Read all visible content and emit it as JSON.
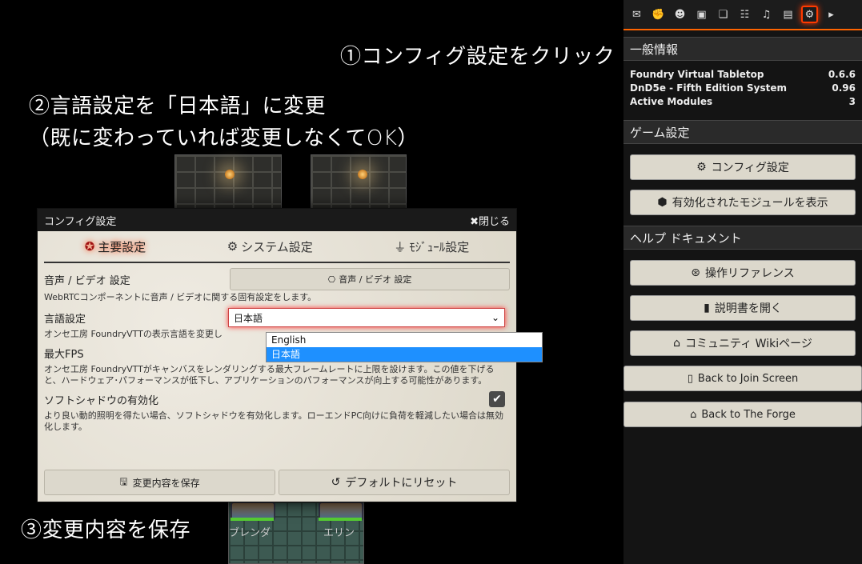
{
  "annotations": {
    "step1": "①コンフィグ設定をクリック",
    "step2a": "②言語設定を「日本語」に変更",
    "step2b": "（既に変わっていれば変更しなくてOK）",
    "step3": "③変更内容を保存"
  },
  "tokens": [
    "ブレンダ",
    "エリン"
  ],
  "dialog": {
    "title": "コンフィグ設定",
    "close": "✖閉じる",
    "tabs": [
      {
        "label": "主要設定",
        "icon": "✪"
      },
      {
        "label": "システム設定",
        "icon": "⚙"
      },
      {
        "label": "ﾓｼﾞｭｰﾙ設定",
        "icon": "⏚"
      }
    ],
    "av": {
      "label": "音声 / ビデオ 設定",
      "button": "音声 / ビデオ 設定",
      "hint": "WebRTCコンポーネントに音声 / ビデオに関する固有設定をします。"
    },
    "language": {
      "label": "言語設定",
      "value": "日本語",
      "hint": "オンセ工房 FoundryVTTの表示言語を変更し",
      "options": [
        "English",
        "日本語"
      ]
    },
    "fps": {
      "label": "最大FPS",
      "hint": "オンセ工房 FoundryVTTがキャンバスをレンダリングする最大フレームレートに上限を設けます。この値を下げると、ハードウェア･パフォーマンスが低下し、アプリケーションのパフォーマンスが向上する可能性があります。"
    },
    "softshadow": {
      "label": "ソフトシャドウの有効化",
      "hint": "より良い動的照明を得たい場合、ソフトシャドウを有効化します。ローエンドPC向けに負荷を軽減したい場合は無効化します。",
      "checked": true
    },
    "save": "変更内容を保存",
    "reset": "デフォルトにリセット"
  },
  "sidebar": {
    "tabs": [
      "chat-icon",
      "combat-icon",
      "actors-icon",
      "items-icon",
      "journal-icon",
      "tables-icon",
      "playlists-icon",
      "compendium-icon",
      "settings-icon",
      "collapse-icon"
    ],
    "general_header": "一般情報",
    "info": [
      {
        "name": "Foundry Virtual Tabletop",
        "value": "0.6.6"
      },
      {
        "name": "DnD5e - Fifth Edition System",
        "value": "0.96"
      },
      {
        "name": "Active Modules",
        "value": "3"
      }
    ],
    "game_header": "ゲーム設定",
    "config_btn": "コンフィグ設定",
    "modules_btn": "有効化されたモジュールを表示",
    "help_header": "ヘルプ ドキュメント",
    "controls_btn": "操作リファレンス",
    "manual_btn": "説明書を開く",
    "wiki_btn": "コミュニティ Wikiページ",
    "join_btn": "Back to Join Screen",
    "forge_btn": "Back to The Forge"
  }
}
